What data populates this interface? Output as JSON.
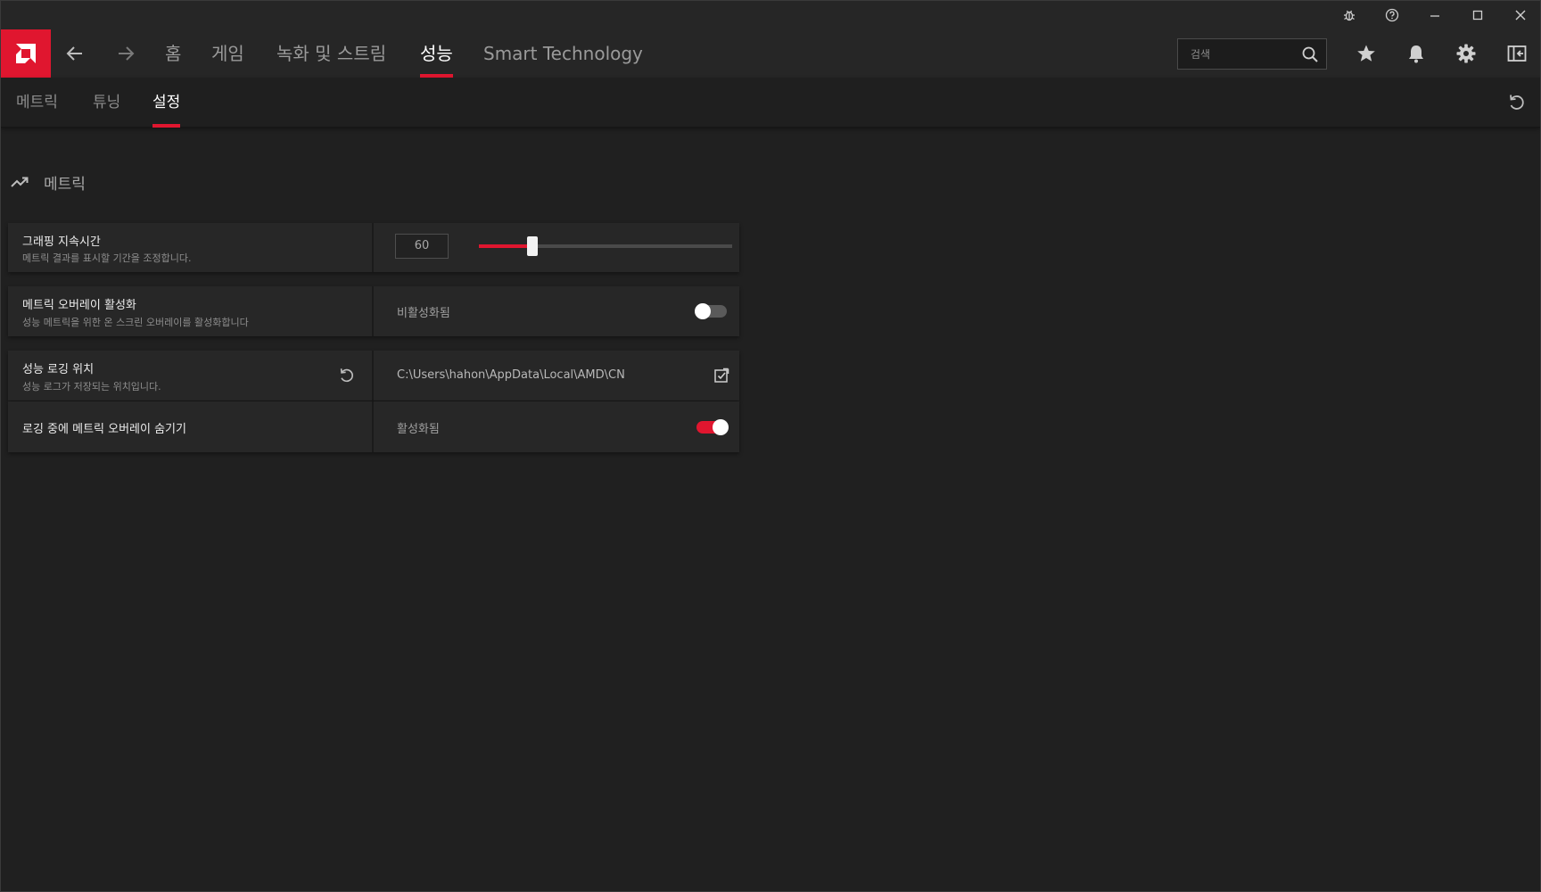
{
  "header": {
    "nav": [
      "홈",
      "게임",
      "녹화 및 스트림",
      "성능",
      "Smart Technology"
    ],
    "active_nav": "성능"
  },
  "search": {
    "placeholder": "검색"
  },
  "subtabs": [
    "메트릭",
    "튜닝",
    "설정"
  ],
  "section": {
    "title": "메트릭"
  },
  "settings": [
    {
      "title": "그래핑 지속시간",
      "desc": "메트릭 결과를 표시할 기간을 조정합니다.",
      "value": "60",
      "slider_fraction": 0.21
    },
    {
      "title": "메트릭 오버레이 활성화",
      "desc": "성능 메트릭을 위한 온 스크린 오버레이를 활성화합니다",
      "state": "비활성화됨",
      "enabled": false
    },
    {
      "title": "성능 로깅 위치",
      "desc": "성능 로그가 저장되는 위치입니다.",
      "path": "C:\\Users\\hahon\\AppData\\Local\\AMD\\CN"
    },
    {
      "title": "로깅 중에 메트릭 오버레이 숨기기",
      "state": "활성화됨",
      "enabled": true
    }
  ],
  "colors": {
    "accent": "#e0162f",
    "background": "#202020",
    "panel": "#272727"
  },
  "icons": [
    "amd-logo-icon",
    "back-arrow-icon",
    "forward-arrow-icon",
    "search-icon",
    "star-icon",
    "bell-icon",
    "gear-icon",
    "sidebar-toggle-icon",
    "bug-icon",
    "help-icon",
    "minimize-icon",
    "maximize-icon",
    "close-icon",
    "reset-icon",
    "trend-icon",
    "folder-browse-icon"
  ]
}
